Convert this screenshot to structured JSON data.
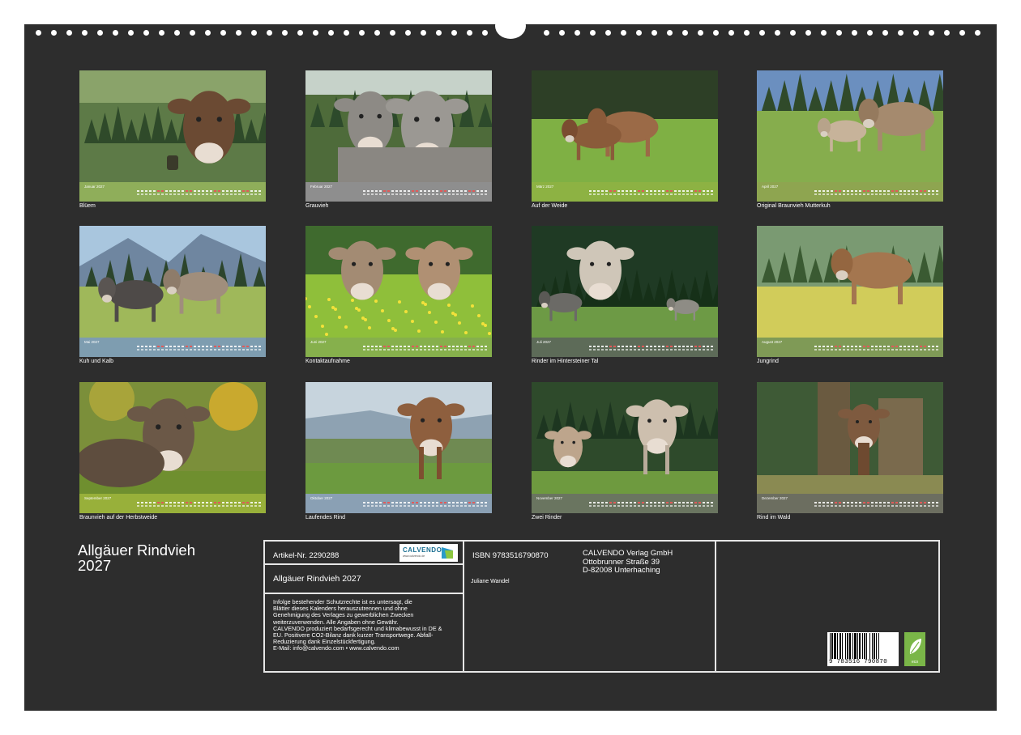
{
  "calendar": {
    "title_line1": "Allgäuer Rindvieh",
    "title_line2": "2027"
  },
  "months": [
    {
      "label": "Januar 2027",
      "caption": "Blüem",
      "bar_color": "#8fae5a",
      "scene": "cow-closeup"
    },
    {
      "label": "Februar 2027",
      "caption": "Grauvieh",
      "bar_color": "#8e8e8e",
      "scene": "two-cows-heads"
    },
    {
      "label": "März 2027",
      "caption": "Auf der Weide",
      "bar_color": "#8db243",
      "scene": "cows-meadow"
    },
    {
      "label": "April 2027",
      "caption": "Original Braunvieh Mutterkuh",
      "bar_color": "#8ea550",
      "scene": "cow-calf-meadow"
    },
    {
      "label": "Mai 2027",
      "caption": "Kuh und Kalb",
      "bar_color": "#7e9db0",
      "scene": "cow-calf-mountains"
    },
    {
      "label": "Juni 2027",
      "caption": "Kontaktaufnahme",
      "bar_color": "#86b04c",
      "scene": "two-cows-flowers"
    },
    {
      "label": "Juli 2027",
      "caption": "Rinder im Hintersteiner Tal",
      "bar_color": "#5d6b58",
      "scene": "cows-forest"
    },
    {
      "label": "August 2027",
      "caption": "Jungrind",
      "bar_color": "#7f9a56",
      "scene": "young-cow"
    },
    {
      "label": "September 2027",
      "caption": "Braunvieh auf der Herbstweide",
      "bar_color": "#98b03a",
      "scene": "autumn-cow"
    },
    {
      "label": "Oktober 2027",
      "caption": "Laufendes Rind",
      "bar_color": "#8aa0b4",
      "scene": "running-cow"
    },
    {
      "label": "November 2027",
      "caption": "Zwei Rinder",
      "bar_color": "#6a7560",
      "scene": "two-cows-forest"
    },
    {
      "label": "Dezember 2027",
      "caption": "Rind im Wald",
      "bar_color": "#6c6e60",
      "scene": "cow-in-forest"
    }
  ],
  "info": {
    "article_no": "Artikel-Nr. 2290288",
    "logo_text": "CALVENDO",
    "logo_subtext": "www.calvendo.de",
    "product_title": "Allgäuer Rindvieh 2027",
    "legal_lines": [
      "Infolge bestehender Schutzrechte ist es untersagt, die",
      "Blätter dieses Kalenders herauszutrennen und ohne",
      "Genehmigung des Verlages zu gewerblichen Zwecken",
      "weiterzuverwenden. Alle Angaben ohne Gewähr.",
      "CALVENDO produziert bedarfsgerecht und klimabewusst in DE &",
      "EU. Positivere CO2-Bilanz dank kurzer Transportwege. Abfall-",
      "Reduzierung dank Einzelstückfertigung.",
      "E-Mail: info@calvendo.com • www.calvendo.com"
    ],
    "isbn": "ISBN 9783516790870",
    "author": "Juliane Wandel",
    "publisher_name": "CALVENDO Verlag GmbH",
    "publisher_street": "Ottobrunner Straße 39",
    "publisher_city": "D-82008 Unterhaching",
    "barcode_number": "9 783516 790870",
    "eco_label": "eco"
  },
  "colors": {
    "background": "#2d2d2d",
    "text": "#ffffff",
    "box_border": "#e6e6e6",
    "eco_green": "#7ab648"
  }
}
